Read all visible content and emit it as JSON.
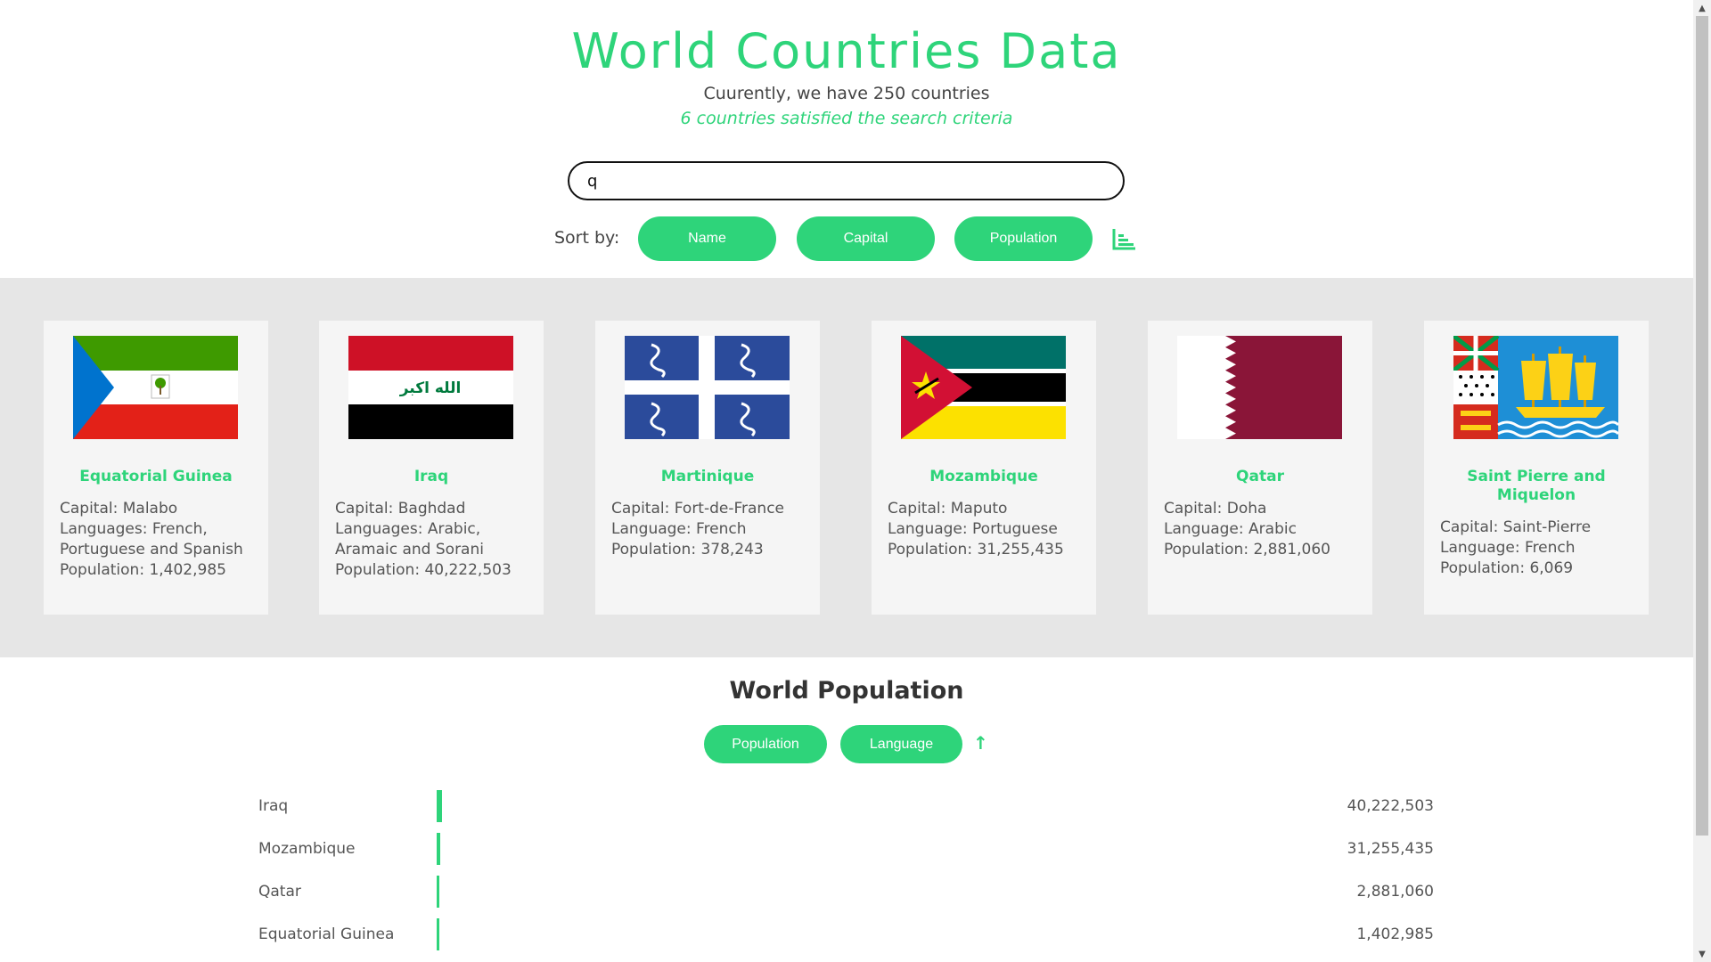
{
  "header": {
    "title": "World Countries Data",
    "subtitle": "Cuurently, we have 250 countries",
    "criteria": "6 countries satisfied the search criteria"
  },
  "search": {
    "value": "q",
    "placeholder": ""
  },
  "sort": {
    "label": "Sort by:",
    "name_label": "Name",
    "capital_label": "Capital",
    "population_label": "Population",
    "icon": "bar-chart-icon"
  },
  "cards": [
    {
      "name": "Equatorial Guinea",
      "capital": "Capital: Malabo",
      "languages": "Languages: French, Portuguese and Spanish",
      "population": "Population: 1,402,985",
      "flag": "equatorial-guinea-flag"
    },
    {
      "name": "Iraq",
      "capital": "Capital: Baghdad",
      "languages": "Languages: Arabic, Aramaic and Sorani",
      "population": "Population: 40,222,503",
      "flag": "iraq-flag",
      "flag_text": "الله اكبر"
    },
    {
      "name": "Martinique",
      "capital": "Capital: Fort-de-France",
      "languages": "Language: French",
      "population": "Population: 378,243",
      "flag": "martinique-flag"
    },
    {
      "name": "Mozambique",
      "capital": "Capital: Maputo",
      "languages": "Language: Portuguese",
      "population": "Population: 31,255,435",
      "flag": "mozambique-flag"
    },
    {
      "name": "Qatar",
      "capital": "Capital: Doha",
      "languages": "Language: Arabic",
      "population": "Population: 2,881,060",
      "flag": "qatar-flag"
    },
    {
      "name": "Saint Pierre and Miquelon",
      "capital": "Capital: Saint-Pierre",
      "languages": "Language: French",
      "population": "Population: 6,069",
      "flag": "saint-pierre-and-miquelon-flag"
    }
  ],
  "population_section": {
    "title": "World Population",
    "population_button": "Population",
    "language_button": "Language",
    "sort_icon": "arrow-up-icon",
    "rows": [
      {
        "label": "Iraq",
        "value": "40,222,503",
        "population": 40222503
      },
      {
        "label": "Mozambique",
        "value": "31,255,435",
        "population": 31255435
      },
      {
        "label": "Qatar",
        "value": "2,881,060",
        "population": 2881060
      },
      {
        "label": "Equatorial Guinea",
        "value": "1,402,985",
        "population": 1402985
      }
    ]
  },
  "colors": {
    "accent": "#2ed47a",
    "cards_bg": "#e6e6e6",
    "card_bg": "#f5f5f5"
  }
}
